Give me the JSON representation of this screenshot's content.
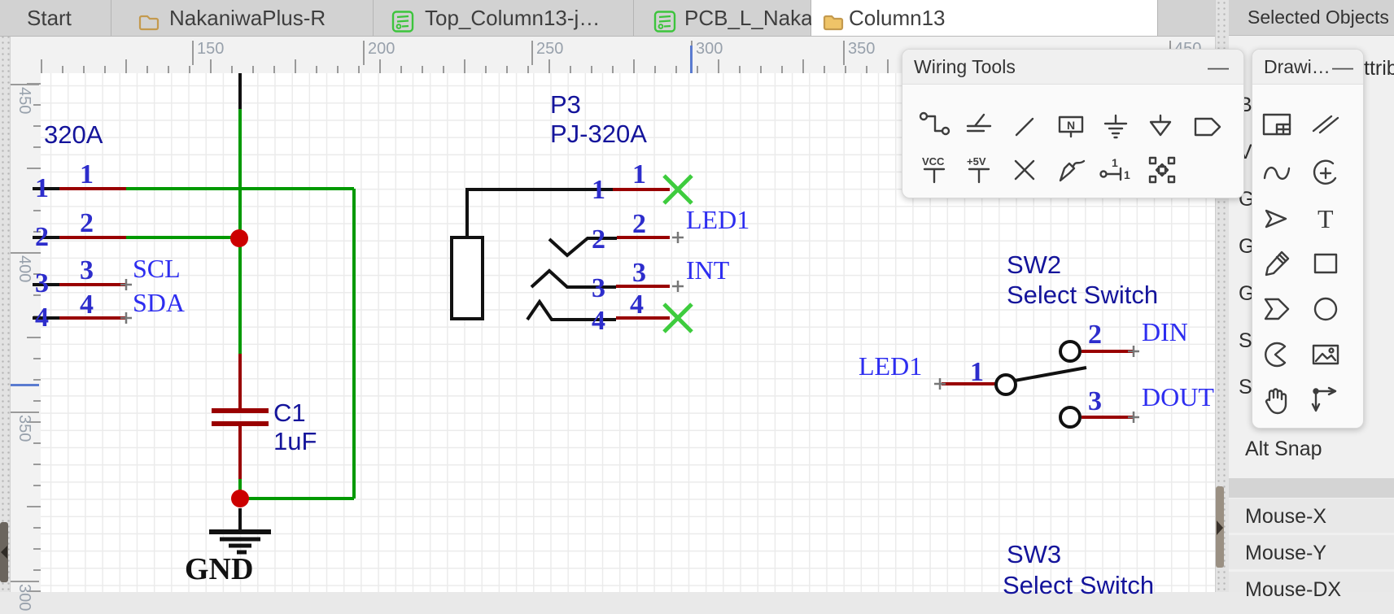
{
  "window": {
    "tabs": [
      {
        "label": "Start",
        "icon": "none"
      },
      {
        "label": "NakaniwaPlus-R",
        "icon": "folder-outline"
      },
      {
        "label": "Top_Column13-j…",
        "icon": "schematic-doc"
      },
      {
        "label": "PCB_L_Nakaniw…",
        "icon": "pcb-doc"
      },
      {
        "label": "Column13",
        "icon": "folder-filled",
        "active": true
      }
    ]
  },
  "rulers": {
    "top_labels": [
      "150",
      "200",
      "250",
      "300",
      "350",
      "450"
    ],
    "left_labels": [
      "450",
      "400",
      "350",
      "300"
    ]
  },
  "wiring_tools": {
    "title": "Wiring Tools",
    "minimize_label": "—",
    "glyphs": {
      "netlabel": "N",
      "vcc": "VCC",
      "plus5v": "+5V",
      "pin_top": "1",
      "pin_right": "1"
    },
    "icons_row1": [
      "wire",
      "bus",
      "bus-entry",
      "netlabel",
      "ground",
      "gnd-power",
      "netflag"
    ],
    "icons_row2": [
      "vcc",
      "plus5v",
      "no-connect",
      "voltage-probe",
      "pin",
      "group"
    ]
  },
  "drawing_tools": {
    "title": "Drawi…",
    "minimize_label": "—",
    "glyphs": {
      "text_tool": "T"
    },
    "icons": [
      "frame",
      "polyline",
      "bezier",
      "arc",
      "arrow",
      "text",
      "pencil",
      "rect",
      "polygon",
      "ellipse",
      "pie",
      "image",
      "drag",
      "dimension"
    ]
  },
  "right_panel": {
    "header": "Selected Objects",
    "attributes_header_partial": "ttrib",
    "clipped_attribute_letters": [
      "B",
      "V",
      "G",
      "G",
      "G",
      "S",
      "S"
    ],
    "alt_snap_label": "Alt Snap",
    "mouse_rows": [
      "Mouse-X",
      "Mouse-Y",
      "Mouse-DX"
    ]
  },
  "schematic": {
    "ic": {
      "name": "320A",
      "pin_numbers": [
        "1",
        "2",
        "3",
        "4"
      ],
      "pin_names": [
        "1",
        "2",
        "3",
        "4"
      ],
      "net_scl": "SCL",
      "net_sda": "SDA"
    },
    "cap": {
      "ref": "C1",
      "value": "1uF"
    },
    "gnd_label": "GND",
    "jack": {
      "ref": "P3",
      "value": "PJ-320A",
      "pin_numbers": [
        "1",
        "2",
        "3",
        "4"
      ],
      "pin_names": [
        "1",
        "2",
        "3",
        "4"
      ],
      "net_led1": "LED1",
      "net_int": "INT"
    },
    "sw2": {
      "ref": "SW2",
      "value": "Select Switch",
      "pin1": "1",
      "pin2": "2",
      "pin3": "3",
      "net_led1": "LED1",
      "net_din": "DIN",
      "net_dout": "DOUT"
    },
    "sw3": {
      "ref": "SW3",
      "value": "Select Switch"
    },
    "colors": {
      "wire_green": "#009900",
      "pin_red": "#990000",
      "junction": "#cc0000",
      "no_connect_x": "#3ecc3e",
      "net_label_blue": "#2d2df0",
      "ref_navy": "#14149b",
      "pin_number_blue": "#2d2dcc"
    }
  }
}
